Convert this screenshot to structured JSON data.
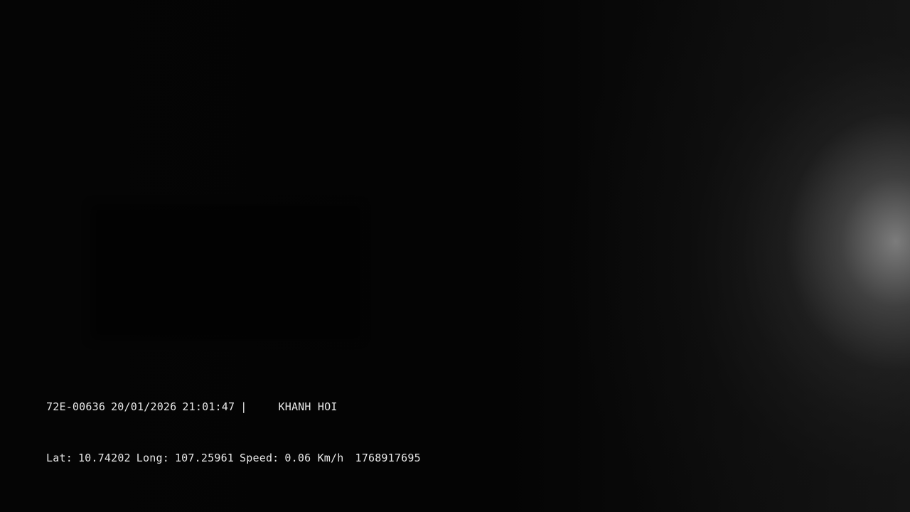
{
  "osd": {
    "plate": "72E-00636",
    "date": "20/01/2026",
    "time": "21:01:47",
    "separator": "|",
    "location": "KHANH HOI",
    "lat_label": "Lat:",
    "lat_value": "10.74202",
    "long_label": "Long:",
    "long_value": "107.25961",
    "speed_label": "Speed:",
    "speed_value": "0.06 Km/h",
    "timestamp": "1768917695"
  }
}
